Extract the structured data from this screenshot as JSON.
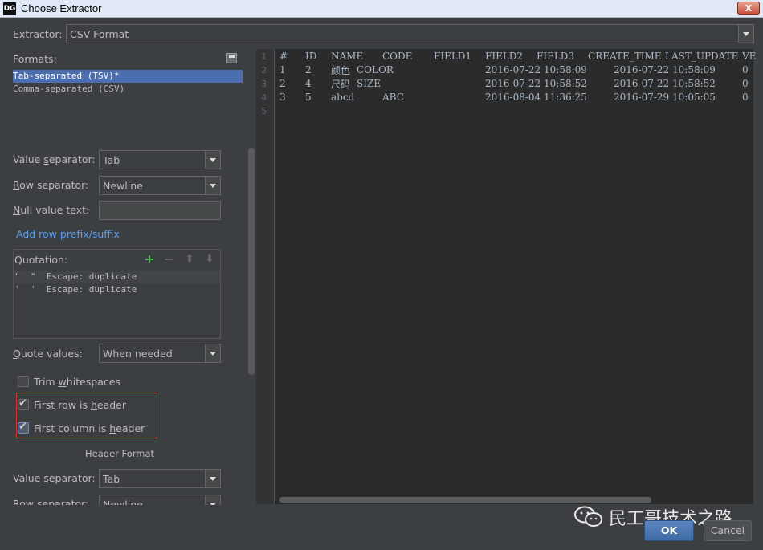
{
  "window": {
    "title": "Choose Extractor",
    "app_icon": "DG",
    "close_label": "X"
  },
  "extractor": {
    "label_pre": "E",
    "label_u": "x",
    "label_post": "tractor:",
    "value": "CSV Format"
  },
  "formats": {
    "label": "Formats:",
    "items": [
      "Tab-separated (TSV)*",
      "Comma-separated (CSV)"
    ],
    "selected_index": 0
  },
  "settings": {
    "value_separator": {
      "label_pre": "Value ",
      "label_u": "s",
      "label_post": "eparator:",
      "value": "Tab"
    },
    "row_separator": {
      "label_pre": "",
      "label_u": "R",
      "label_post": "ow separator:",
      "value": "Newline"
    },
    "null_value_text": {
      "label_pre": "",
      "label_u": "N",
      "label_post": "ull value text:",
      "value": ""
    },
    "add_prefix_link": "Add row prefix/suffix"
  },
  "quotation": {
    "label": "Quotation:",
    "rows": [
      "\"  \"  Escape: duplicate",
      "'  '  Escape: duplicate"
    ]
  },
  "quote_values": {
    "label_pre": "",
    "label_u": "Q",
    "label_post": "uote values:",
    "value": "When needed"
  },
  "checkboxes": {
    "trim": {
      "label_pre": "Trim ",
      "label_u": "w",
      "label_post": "hitespaces",
      "checked": false
    },
    "first_row_header": {
      "label_pre": "First row is ",
      "label_u": "h",
      "label_post": "eader",
      "checked": true
    },
    "first_col_header": {
      "label_pre": "First column is ",
      "label_u": "h",
      "label_post": "eader",
      "checked": true
    }
  },
  "header_format": {
    "title": "Header Format",
    "value_separator": {
      "label_pre": "Value ",
      "label_u": "s",
      "label_post": "eparator:",
      "value": "Tab"
    },
    "row_separator": {
      "label_pre": "Row separator:",
      "value": "Newline"
    }
  },
  "preview": {
    "line_numbers": [
      "1",
      "2",
      "3",
      "4",
      "5"
    ],
    "rows": [
      [
        "#",
        "ID",
        "NAME",
        "CODE",
        "FIELD1",
        "FIELD2",
        "FIELD3",
        "CREATE_TIME",
        "LAST_UPDATE",
        "VE"
      ],
      [
        "1",
        "2",
        "颜色",
        "COLOR",
        "",
        "",
        "2016-07-22 10:58:09",
        "2016-07-22 10:58:09",
        "0"
      ],
      [
        "2",
        "4",
        "尺码",
        "SIZE",
        "",
        "",
        "2016-07-22 10:58:52",
        "2016-07-22 10:58:52",
        "0"
      ],
      [
        "3",
        "5",
        "abcd",
        "ABC",
        "",
        "",
        "2016-08-04 11:36:25",
        "2016-07-29 10:05:05",
        "0"
      ]
    ]
  },
  "watermark": {
    "text": "民工哥技术之路",
    "icon": "wechat-icon"
  },
  "buttons": {
    "ok": "OK",
    "cancel": "Cancel"
  }
}
